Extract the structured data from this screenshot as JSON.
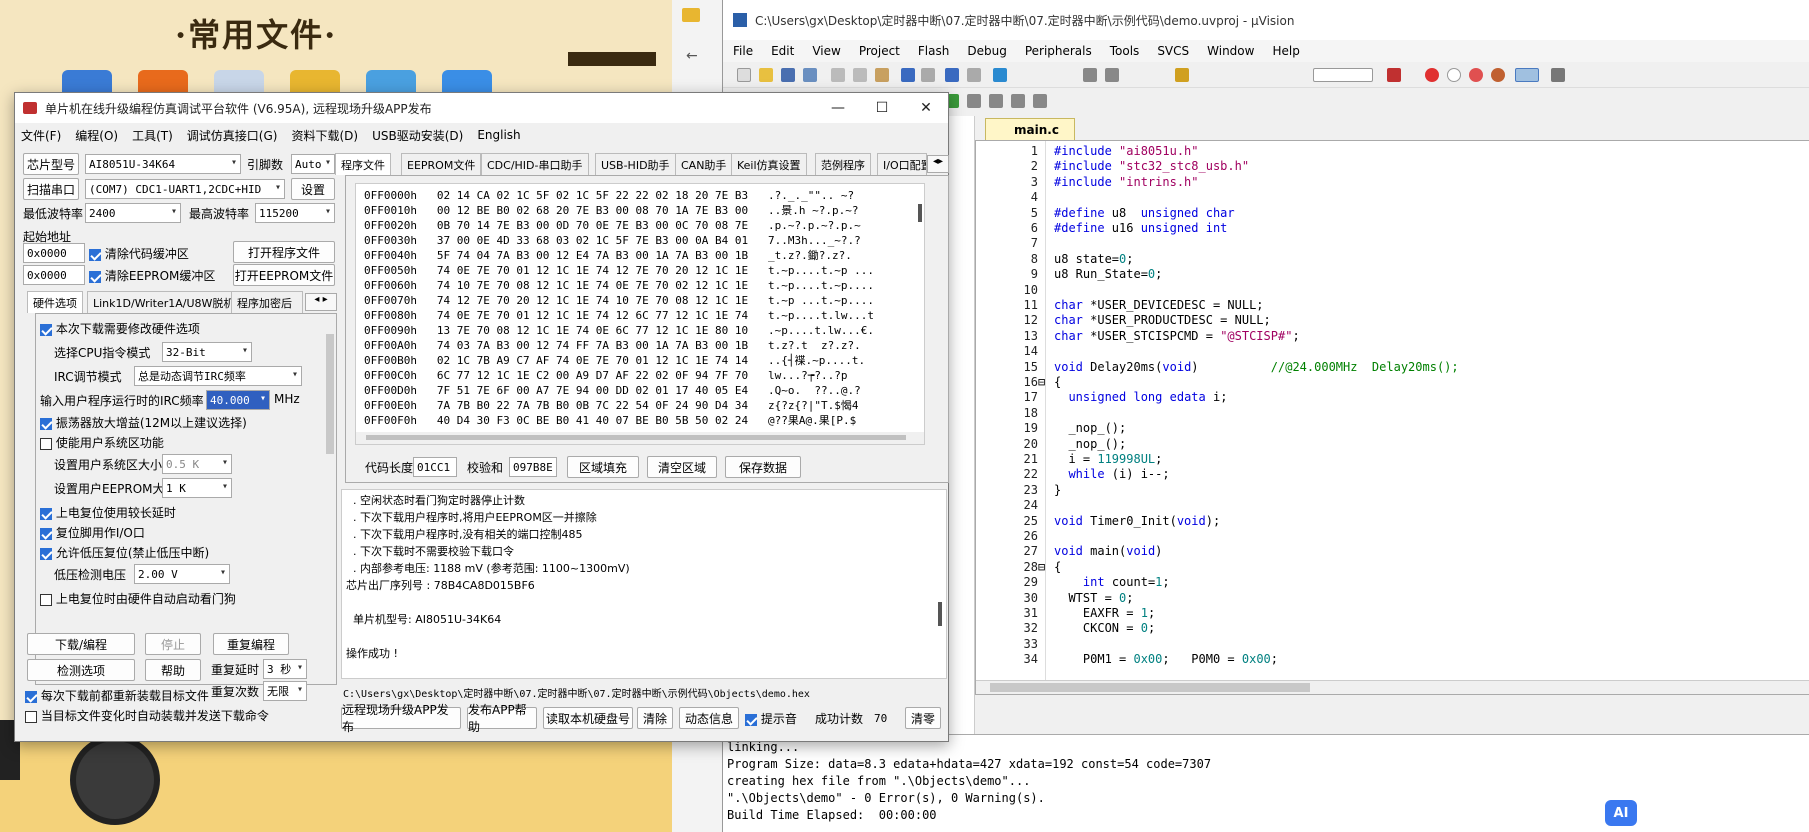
{
  "wallpaper": {
    "title": "·常用文件·"
  },
  "programmer": {
    "title": "单片机在线升级编程仿真调试平台软件 (V6.95A), 远程现场升级APP发布",
    "menu": [
      "文件(F)",
      "编程(O)",
      "工具(T)",
      "调试仿真接口(G)",
      "资料下载(D)",
      "USB驱动安装(D)",
      "English"
    ],
    "chip_label": "芯片型号",
    "chip_value": "AI8051U-34K64",
    "pin_label": "引脚数",
    "pin_value": "Auto",
    "scan_port": "扫描串口",
    "port_value": "(COM7) CDC1-UART1,2CDC+HID",
    "settings": "设置",
    "min_baud_label": "最低波特率",
    "min_baud": "2400",
    "max_baud_label": "最高波特率",
    "max_baud": "115200",
    "start_addr_label": "起始地址",
    "addr1": "0x0000",
    "clear_code": "清除代码缓冲区",
    "open_prog": "打开程序文件",
    "addr2": "0x0000",
    "clear_eeprom": "清除EEPROM缓冲区",
    "open_eeprom": "打开EEPROM文件",
    "left_tabs": [
      "硬件选项",
      "Link1D/Writer1A/U8W脱机",
      "程序加密后"
    ],
    "hw": {
      "opt1": "本次下载需要修改硬件选项",
      "cpu_label": "选择CPU指令模式",
      "cpu_value": "32-Bit",
      "irc_label": "IRC调节模式",
      "irc_value": "总是动态调节IRC频率",
      "freq_label": "输入用户程序运行时的IRC频率",
      "freq_value": "40.000",
      "freq_unit": "MHz",
      "opt2": "振荡器放大增益(12M以上建议选择)",
      "opt3": "使能用户系统区功能",
      "sys_size_label": "设置用户系统区大小",
      "sys_size_value": "0.5 K",
      "eeprom_label": "设置用户EEPROM大小",
      "eeprom_value": "1   K",
      "opt4": "上电复位使用较长延时",
      "opt5": "复位脚用作I/O口",
      "opt6": "允许低压复位(禁止低压中断)",
      "lv_label": "低压检测电压",
      "lv_value": "2.00 V",
      "opt7": "上电复位时由硬件自动启动看门狗"
    },
    "btn_download": "下载/编程",
    "btn_stop": "停止",
    "btn_reprog": "重复编程",
    "btn_check": "检测选项",
    "btn_help": "帮助",
    "delay_label": "重复延时",
    "delay_value": "3 秒",
    "count_label": "重复次数",
    "count_value": "无限",
    "reload_opt": "每次下载前都重新装载目标文件",
    "auto_opt": "当目标文件变化时自动装载并发送下载命令",
    "right_tabs": [
      "程序文件",
      "EEPROM文件",
      "CDC/HID-串口助手",
      "USB-HID助手",
      "CAN助手",
      "Keil仿真设置",
      "范例程序",
      "I/O口配置"
    ],
    "hex_rows": [
      "0FF0000h   02 14 CA 02 1C 5F 02 1C 5F 22 22 02 18 20 7E B3   .?._._\"\".. ~?",
      "0FF0010h   00 12 BE B0 02 68 20 7E B3 00 08 70 1A 7E B3 00   ..景.h ~?.p.~?",
      "0FF0020h   0B 70 14 7E B3 00 0D 70 0E 7E B3 00 0C 70 08 7E   .p.~?.p.~?.p.~",
      "0FF0030h   37 00 0E 4D 33 68 03 02 1C 5F 7E B3 00 0A B4 01   7..M3h..._~?.?",
      "0FF0040h   5F 74 04 7A B3 00 12 E4 7A B3 00 1A 7A B3 00 1B   _t.z?.鋤?.z?.",
      "0FF0050h   74 0E 7E 70 01 12 1C 1E 74 12 7E 70 20 12 1C 1E   t.~p....t.~p ...",
      "0FF0060h   74 10 7E 70 08 12 1C 1E 74 0E 7E 70 02 12 1C 1E   t.~p....t.~p....",
      "0FF0070h   74 12 7E 70 20 12 1C 1E 74 10 7E 70 08 12 1C 1E   t.~p ...t.~p....",
      "0FF0080h   74 0E 7E 70 01 12 1C 1E 74 12 6C 77 12 1C 1E 74   t.~p....t.lw...t",
      "0FF0090h   13 7E 70 08 12 1C 1E 74 0E 6C 77 12 1C 1E 80 10   .~p....t.lw...€.",
      "0FF00A0h   74 03 7A B3 00 12 74 FF 7A B3 00 1A 7A B3 00 1B   t.z?.t  z?.z?.",
      "0FF00B0h   02 1C 7B A9 C7 AF 74 0E 7E 70 01 12 1C 1E 74 14   ..{┤褋.~p....t.",
      "0FF00C0h   6C 77 12 1C 1E C2 00 A9 D7 AF 22 02 0F 94 7F 70   lw...?┮?..?p",
      "0FF00D0h   7F 51 7E 6F 00 A7 7E 94 00 DD 02 01 17 40 05 E4   .Q~o.  ??..@.?",
      "0FF00E0h   7A 7B B0 22 7A 7B B0 0B 7C 22 54 0F 24 90 D4 34   z{?z{?|\"T.$愒4",
      "0FF00F0h   40 D4 30 F3 0C BE B0 41 40 07 BE B0 5B 50 02 24   @??果A@.果[P.$"
    ],
    "code_len_label": "代码长度",
    "code_len": "01CC1",
    "checksum_label": "校验和",
    "checksum": "097B8E",
    "fill_btn": "区域填充",
    "clear_btn": "清空区域",
    "save_btn": "保存数据",
    "log": [
      "  . 空闲状态时看门狗定时器停止计数",
      "  . 下次下载用户程序时,将用户EEPROM区一并擦除",
      "  . 下次下载用户程序时,没有相关的端口控制485",
      "  . 下次下载时不需要校验下载口令",
      "  . 内部参考电压: 1188 mV (参考范围: 1100~1300mV)",
      "芯片出厂序列号 : 78B4CA8D015BF6",
      "",
      "  单片机型号: AI8051U-34K64",
      "",
      "操作成功 !"
    ],
    "file_path": "C:\\Users\\gx\\Desktop\\定时器中断\\07.定时器中断\\07.定时器中断\\示例代码\\Objects\\demo.hex",
    "bottom_btns": [
      "远程现场升级APP发布",
      "发布APP帮助",
      "读取本机硬盘号",
      "清除",
      "动态信息"
    ],
    "tip_label": "提示音",
    "success_label": "成功计数",
    "success_count": "70",
    "clear_count": "清零"
  },
  "uvision": {
    "title": "C:\\Users\\gx\\Desktop\\定时器中断\\07.定时器中断\\07.定时器中断\\示例代码\\demo.uvproj - µVision",
    "menu": [
      "File",
      "Edit",
      "View",
      "Project",
      "Flash",
      "Debug",
      "Peripherals",
      "Tools",
      "SVCS",
      "Window",
      "Help"
    ],
    "tab": "main.c",
    "code": [
      [
        "1",
        "#include \"ai8051u.h\""
      ],
      [
        "2",
        "#include \"stc32_stc8_usb.h\""
      ],
      [
        "3",
        "#include \"intrins.h\""
      ],
      [
        "4",
        ""
      ],
      [
        "5",
        "#define u8  unsigned char"
      ],
      [
        "6",
        "#define u16 unsigned int"
      ],
      [
        "7",
        ""
      ],
      [
        "8",
        "u8 state=0;"
      ],
      [
        "9",
        "u8 Run_State=0;"
      ],
      [
        "10",
        ""
      ],
      [
        "11",
        "char *USER_DEVICEDESC = NULL;"
      ],
      [
        "12",
        "char *USER_PRODUCTDESC = NULL;"
      ],
      [
        "13",
        "char *USER_STCISPCMD = \"@STCISP#\";"
      ],
      [
        "14",
        ""
      ],
      [
        "15",
        "void Delay20ms(void)          //@24.000MHz  Delay20ms();"
      ],
      [
        "16",
        "{"
      ],
      [
        "17",
        "  unsigned long edata i;"
      ],
      [
        "18",
        ""
      ],
      [
        "19",
        "  _nop_();"
      ],
      [
        "20",
        "  _nop_();"
      ],
      [
        "21",
        "  i = 119998UL;"
      ],
      [
        "22",
        "  while (i) i--;"
      ],
      [
        "23",
        "}"
      ],
      [
        "24",
        ""
      ],
      [
        "25",
        "void Timer0_Init(void);"
      ],
      [
        "26",
        ""
      ],
      [
        "27",
        "void main(void)"
      ],
      [
        "28",
        "{"
      ],
      [
        "29",
        "    int count=1;"
      ],
      [
        "30",
        "  WTST = 0;"
      ],
      [
        "31",
        "    EAXFR = 1;"
      ],
      [
        "32",
        "    CKCON = 0;"
      ],
      [
        "33",
        ""
      ],
      [
        "34",
        "    P0M1 = 0x00;   P0M0 = 0x00;"
      ]
    ],
    "build": [
      "linking...",
      "Program Size: data=8.3 edata+hdata=427 xdata=192 const=54 code=7307",
      "creating hex file from \".\\Objects\\demo\"...",
      "\".\\Objects\\demo\" - 0 Error(s), 0 Warning(s).",
      "Build Time Elapsed:  00:00:00"
    ]
  },
  "ai_badge": "AI",
  "colors": {
    "keyword": "#0000e0",
    "string": "#a00060",
    "comment": "#008000",
    "accent": "#2a6fd6"
  }
}
